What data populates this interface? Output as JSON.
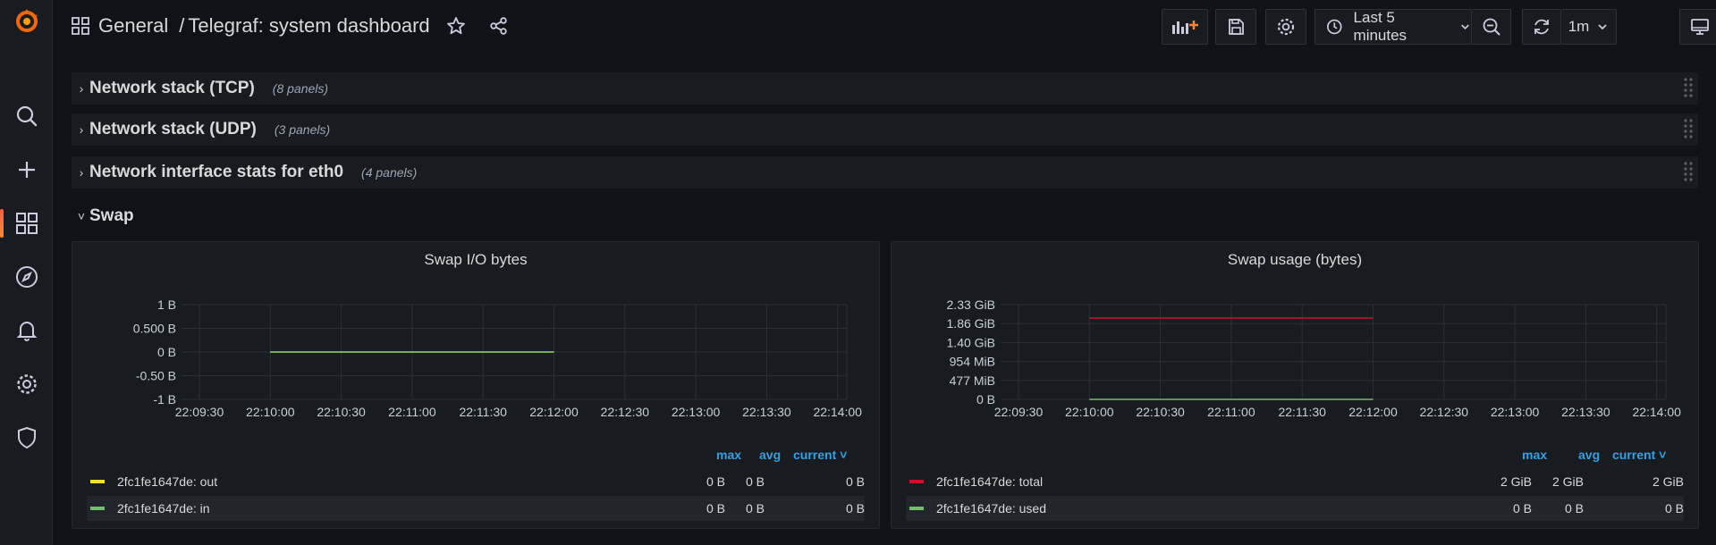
{
  "breadcrumb": {
    "folder": "General",
    "separator": "/",
    "dashboard": "Telegraf: system dashboard"
  },
  "toolbar": {
    "time_range": "Last 5 minutes",
    "refresh_interval": "1m"
  },
  "rows": [
    {
      "title": "Network stack (TCP)",
      "count": "(8 panels)"
    },
    {
      "title": "Network stack (UDP)",
      "count": "(3 panels)"
    },
    {
      "title": "Network interface stats for eth0",
      "count": "(4 panels)"
    }
  ],
  "swap_row": {
    "title": "Swap"
  },
  "legend_headers": {
    "max": "max",
    "avg": "avg",
    "current": "current"
  },
  "panels": [
    {
      "title": "Swap I/O bytes",
      "legend": [
        {
          "name": "2fc1fe1647de: out",
          "color": "#fade2a",
          "max": "0 B",
          "avg": "0 B",
          "current": "0 B"
        },
        {
          "name": "2fc1fe1647de: in",
          "color": "#73bf69",
          "max": "0 B",
          "avg": "0 B",
          "current": "0 B"
        }
      ]
    },
    {
      "title": "Swap usage (bytes)",
      "legend": [
        {
          "name": "2fc1fe1647de: total",
          "color": "#c4162a",
          "max": "2 GiB",
          "avg": "2 GiB",
          "current": "2 GiB"
        },
        {
          "name": "2fc1fe1647de: used",
          "color": "#73bf69",
          "max": "0 B",
          "avg": "0 B",
          "current": "0 B"
        }
      ]
    }
  ],
  "chart_data": [
    {
      "type": "line",
      "title": "Swap I/O bytes",
      "x_ticks": [
        "22:09:30",
        "22:10:00",
        "22:10:30",
        "22:11:00",
        "22:11:30",
        "22:12:00",
        "22:12:30",
        "22:13:00",
        "22:13:30",
        "22:14:00"
      ],
      "y_ticks": [
        "1 B",
        "0.500 B",
        "0 B",
        "-0.50 B",
        "-1 B"
      ],
      "ylim": [
        -1,
        1
      ],
      "grid": true,
      "series": [
        {
          "name": "2fc1fe1647de: out",
          "color": "#fade2a",
          "x": [
            "22:10:00",
            "22:12:00"
          ],
          "y": [
            0,
            0
          ]
        },
        {
          "name": "2fc1fe1647de: in",
          "color": "#73bf69",
          "x": [
            "22:10:00",
            "22:12:00"
          ],
          "y": [
            0,
            0
          ]
        }
      ]
    },
    {
      "type": "line",
      "title": "Swap usage (bytes)",
      "x_ticks": [
        "22:09:30",
        "22:10:00",
        "22:10:30",
        "22:11:00",
        "22:11:30",
        "22:12:00",
        "22:12:30",
        "22:13:00",
        "22:13:30",
        "22:14:00"
      ],
      "y_ticks": [
        "2.33 GiB",
        "1.86 GiB",
        "1.40 GiB",
        "954 MiB",
        "477 MiB",
        "0 B"
      ],
      "ylim": [
        0,
        2.33
      ],
      "y_unit": "GiB",
      "grid": true,
      "series": [
        {
          "name": "2fc1fe1647de: total",
          "color": "#c4162a",
          "x": [
            "22:10:00",
            "22:12:00"
          ],
          "y": [
            2,
            2
          ]
        },
        {
          "name": "2fc1fe1647de: used",
          "color": "#73bf69",
          "x": [
            "22:10:00",
            "22:12:00"
          ],
          "y": [
            0,
            0
          ]
        }
      ]
    }
  ]
}
